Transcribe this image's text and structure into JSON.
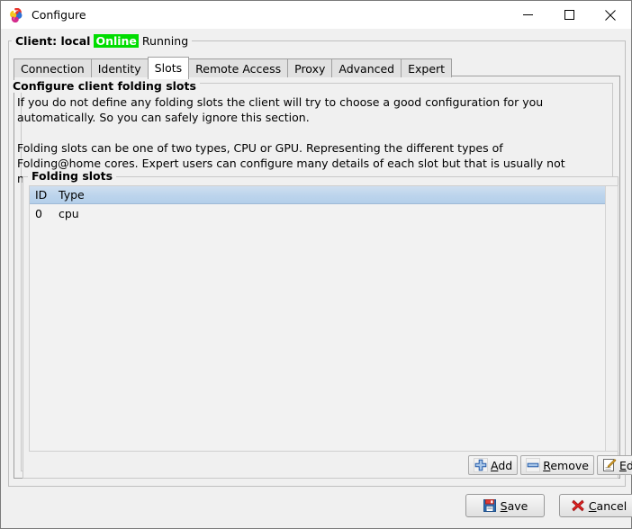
{
  "window": {
    "title": "Configure",
    "app_icon": "folding-at-home-logo-icon",
    "controls": {
      "minimize": "minimize-icon",
      "maximize": "maximize-icon",
      "close": "close-icon"
    }
  },
  "client_status": {
    "label": "Client: local",
    "connection": "Online",
    "state": "Running",
    "online_bg": "#00dd00",
    "online_fg": "#ffffff"
  },
  "tabs": [
    {
      "label": "Connection",
      "active": false
    },
    {
      "label": "Identity",
      "active": false
    },
    {
      "label": "Slots",
      "active": true
    },
    {
      "label": "Remote Access",
      "active": false
    },
    {
      "label": "Proxy",
      "active": false
    },
    {
      "label": "Advanced",
      "active": false
    },
    {
      "label": "Expert",
      "active": false
    }
  ],
  "configure_group": {
    "legend": "Configure client folding slots",
    "paragraph1": "If you do not define any folding slots the client will try to choose a good configuration for you automatically.  So you can safely ignore this section.",
    "paragraph2": "Folding slots can be one of two types, CPU or GPU.  Representing the different types of Folding@home cores. Expert users can configure many details of each slot but that is usually not necessary."
  },
  "slots_group": {
    "legend": "Folding slots",
    "table": {
      "columns": [
        "ID",
        "Type"
      ],
      "rows": [
        {
          "id": "0",
          "type": "cpu"
        }
      ],
      "header_bg": "#b9d2ea"
    },
    "buttons": [
      {
        "label": "Add",
        "mnemonic": "A",
        "prefix": "",
        "suffix": "dd",
        "icon": "plus-icon"
      },
      {
        "label": "Remove",
        "mnemonic": "R",
        "prefix": "",
        "suffix": "emove",
        "icon": "minus-icon"
      },
      {
        "label": "Edit",
        "mnemonic": "E",
        "prefix": "",
        "suffix": "dit",
        "icon": "pencil-edit-icon"
      }
    ]
  },
  "dialog_buttons": [
    {
      "label": "Save",
      "mnemonic": "S",
      "prefix": "",
      "suffix": "ave",
      "icon": "floppy-save-icon"
    },
    {
      "label": "Cancel",
      "mnemonic": "C",
      "prefix": "",
      "suffix": "ancel",
      "icon": "red-x-cancel-icon"
    }
  ]
}
